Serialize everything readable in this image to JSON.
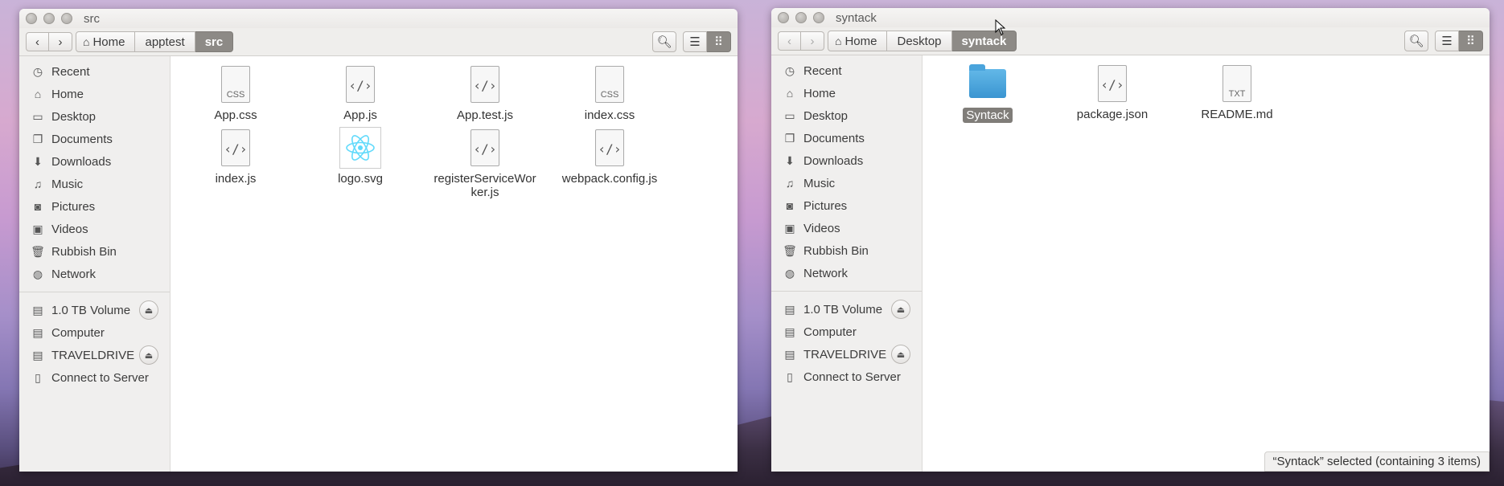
{
  "windows": {
    "left": {
      "title": "src",
      "breadcrumbs": [
        "Home",
        "apptest",
        "src"
      ],
      "files": [
        {
          "name": "App.css",
          "kind": "css",
          "badge": "CSS"
        },
        {
          "name": "App.js",
          "kind": "code",
          "badge": ""
        },
        {
          "name": "App.test.js",
          "kind": "code",
          "badge": ""
        },
        {
          "name": "index.css",
          "kind": "css",
          "badge": "CSS"
        },
        {
          "name": "index.js",
          "kind": "code",
          "badge": ""
        },
        {
          "name": "logo.svg",
          "kind": "svg",
          "badge": ""
        },
        {
          "name": "registerServiceWorker.js",
          "name_line1": "registerServiceWor",
          "name_line2": "ker.js",
          "kind": "code",
          "badge": ""
        },
        {
          "name": "webpack.config.js",
          "kind": "code",
          "badge": ""
        }
      ]
    },
    "right": {
      "title": "syntack",
      "breadcrumbs": [
        "Home",
        "Desktop",
        "syntack"
      ],
      "files": [
        {
          "name": "Syntack",
          "kind": "folder",
          "selected": true
        },
        {
          "name": "package.json",
          "kind": "code",
          "badge": ""
        },
        {
          "name": "README.md",
          "kind": "txt",
          "badge": "TXT"
        }
      ],
      "status": "“Syntack” selected  (containing 3 items)"
    }
  },
  "sidebar": {
    "places": [
      {
        "label": "Recent",
        "icon": "clock-icon"
      },
      {
        "label": "Home",
        "icon": "home-icon"
      },
      {
        "label": "Desktop",
        "icon": "desktop-icon"
      },
      {
        "label": "Documents",
        "icon": "documents-icon"
      },
      {
        "label": "Downloads",
        "icon": "download-icon"
      },
      {
        "label": "Music",
        "icon": "music-icon"
      },
      {
        "label": "Pictures",
        "icon": "camera-icon"
      },
      {
        "label": "Videos",
        "icon": "film-icon"
      },
      {
        "label": "Rubbish Bin",
        "icon": "trash-icon"
      },
      {
        "label": "Network",
        "icon": "network-icon"
      }
    ],
    "devices": [
      {
        "label": "1.0 TB Volume",
        "icon": "drive-icon",
        "eject": true
      },
      {
        "label": "Computer",
        "icon": "drive-icon",
        "eject": false
      },
      {
        "label": "TRAVELDRIVE",
        "icon": "drive-icon",
        "eject": true
      },
      {
        "label": "Connect to Server",
        "icon": "server-icon",
        "eject": false
      }
    ]
  },
  "colors": {
    "selected_crumb": "#8d8a86",
    "folder_blue": "#3a95d1",
    "react_cyan": "#61dafb"
  }
}
